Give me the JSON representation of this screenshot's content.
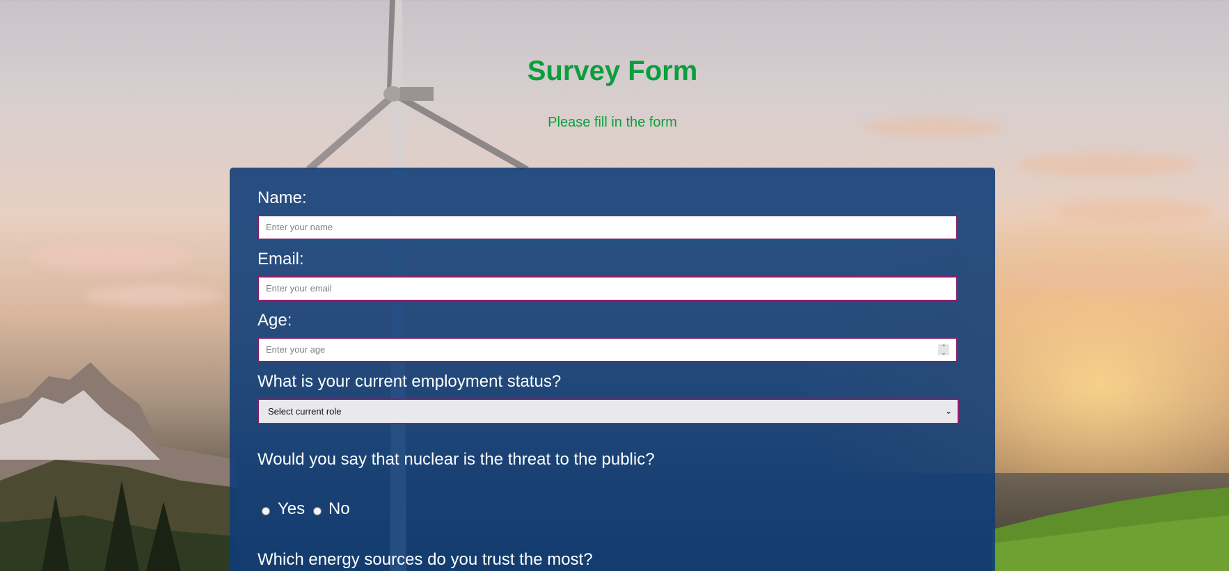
{
  "header": {
    "title": "Survey Form",
    "subtitle": "Please fill in the form"
  },
  "form": {
    "name_label": "Name:",
    "name_placeholder": "Enter your name",
    "email_label": "Email:",
    "email_placeholder": "Enter your email",
    "age_label": "Age:",
    "age_placeholder": "Enter your age",
    "employment_label": "What is your current employment status?",
    "employment_selected": "Select current role",
    "nuclear_question": "Would you say that nuclear is the threat to the public?",
    "nuclear_options": [
      "Yes",
      "No"
    ],
    "energy_question": "Which energy sources do you trust the most?"
  },
  "colors": {
    "accent": "#0c9e3d",
    "card": "#0e3c78",
    "field_border": "#8a1f6b"
  },
  "icons": {
    "select_arrow": "chevron-down-icon",
    "number_spinner": "stepper-icon"
  }
}
